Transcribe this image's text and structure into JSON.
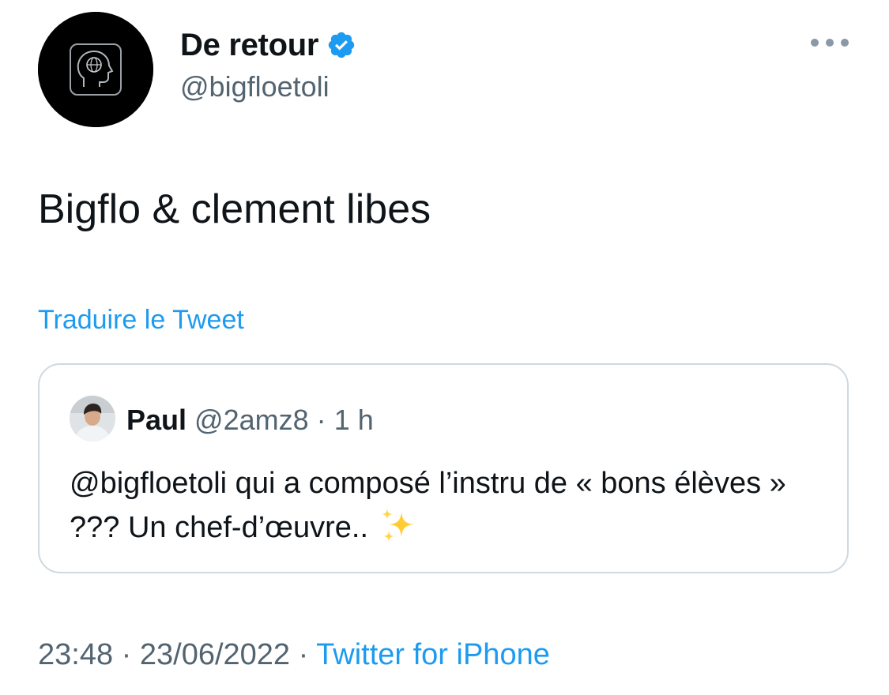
{
  "tweet": {
    "author": {
      "display_name": "De retour",
      "handle": "@bigfloetoli",
      "verified": true,
      "avatar_icon": "head-globe-icon"
    },
    "text": "Bigflo & clement libes",
    "translate_label": "Traduire le Tweet",
    "timestamp": {
      "time": "23:48",
      "separator1": "·",
      "date": "23/06/2022",
      "separator2": "·",
      "source": "Twitter for iPhone"
    },
    "more_icon": "more-icon"
  },
  "quoted_tweet": {
    "author": {
      "display_name": "Paul",
      "handle": "@2amz8",
      "separator": "·",
      "time": "1 h"
    },
    "text": "@bigfloetoli qui a composé l’instru de « bons élèves » ??? Un chef-d’œuvre..",
    "emoji_icon": "sparkles-icon"
  },
  "colors": {
    "accent": "#1d9bf0",
    "secondary_text": "#536471",
    "primary_text": "#0f1419",
    "border": "#cfd9de"
  }
}
